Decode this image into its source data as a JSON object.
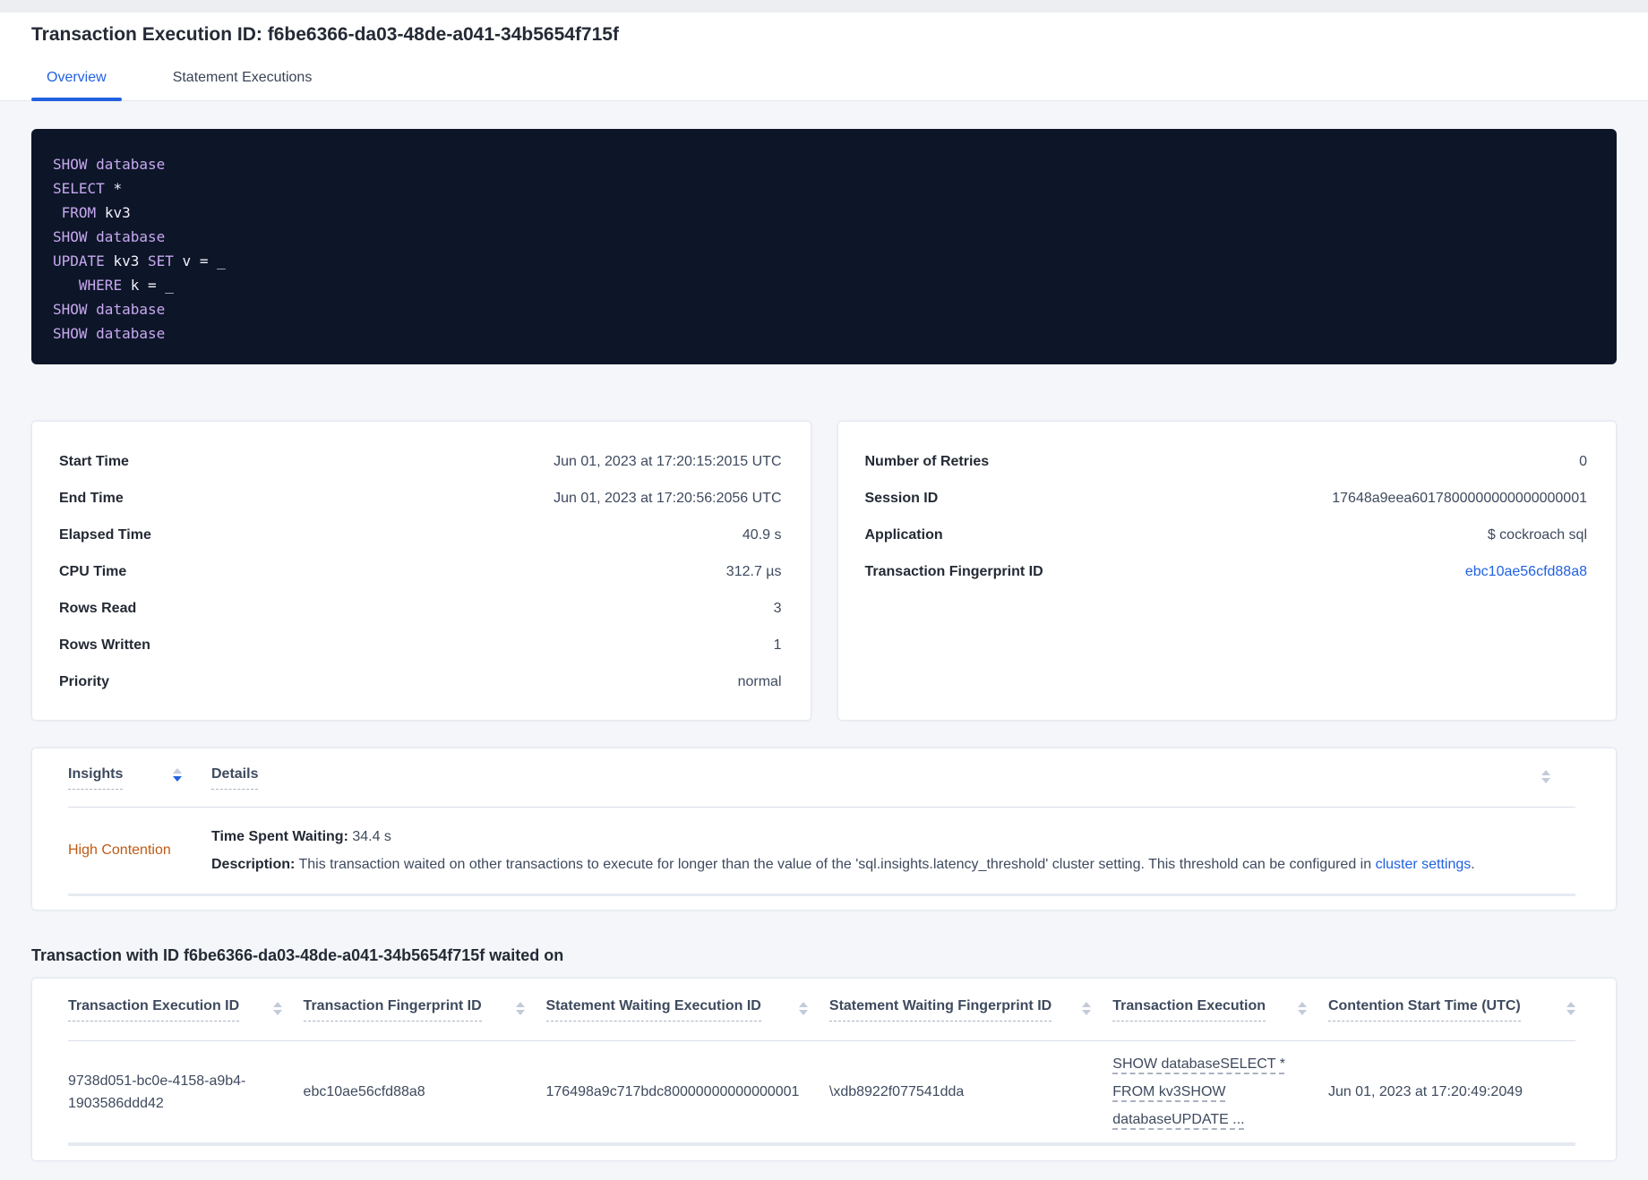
{
  "colors": {
    "accent_blue": "#2161E0",
    "insight_orange": "#C05A13",
    "sql_keyword_purple": "#C7A8F0",
    "sql_box_bg": "#0D1628"
  },
  "page": {
    "title": "Transaction Execution ID: f6be6366-da03-48de-a041-34b5654f715f",
    "tabs": [
      {
        "label": "Overview"
      },
      {
        "label": "Statement Executions"
      }
    ]
  },
  "sql_box": {
    "keywords": [
      "SHOW",
      "SELECT",
      "FROM",
      "UPDATE",
      "SET",
      "WHERE",
      "database"
    ],
    "lines": [
      "SHOW database",
      "SELECT *",
      " FROM kv3",
      "SHOW database",
      "UPDATE kv3 SET v = _",
      "   WHERE k = _",
      "SHOW database",
      "SHOW database"
    ]
  },
  "summary_left": {
    "rows": [
      {
        "label": "Start Time",
        "value": "Jun 01, 2023 at 17:20:15:2015 UTC"
      },
      {
        "label": "End Time",
        "value": "Jun 01, 2023 at 17:20:56:2056 UTC"
      },
      {
        "label": "Elapsed Time",
        "value": "40.9 s"
      },
      {
        "label": "CPU Time",
        "value": "312.7 µs"
      },
      {
        "label": "Rows Read",
        "value": "3"
      },
      {
        "label": "Rows Written",
        "value": "1"
      },
      {
        "label": "Priority",
        "value": "normal"
      }
    ]
  },
  "summary_right": {
    "rows": [
      {
        "label": "Number of Retries",
        "value": "0"
      },
      {
        "label": "Session ID",
        "value": "17648a9eea6017800000000000000001"
      },
      {
        "label": "Application",
        "value": "$ cockroach sql"
      },
      {
        "label": "Transaction Fingerprint ID",
        "value": "ebc10ae56cfd88a8"
      }
    ]
  },
  "insights_table": {
    "col_insights": "Insights",
    "col_details": "Details",
    "row": {
      "insight": "High Contention",
      "time_label": "Time Spent Waiting:",
      "time_value": "34.4 s",
      "desc_label": "Description:",
      "desc_text": "This transaction waited on other transactions to execute for longer than the value of the 'sql.insights.latency_threshold' cluster setting. This threshold can be configured in ",
      "desc_link": "cluster settings",
      "desc_after": "."
    }
  },
  "waited_on": {
    "heading": "Transaction with ID f6be6366-da03-48de-a041-34b5654f715f waited on",
    "columns": [
      "Transaction Execution ID",
      "Transaction Fingerprint ID",
      "Statement Waiting Execution ID",
      "Statement Waiting Fingerprint ID",
      "Transaction Execution",
      "Contention Start Time (UTC)"
    ],
    "row": {
      "transaction_execution_id": "9738d051-bc0e-4158-a9b4-1903586ddd42",
      "transaction_fingerprint_id": "ebc10ae56cfd88a8",
      "statement_waiting_execution_id": "176498a9c717bdc80000000000000001",
      "statement_waiting_fingerprint_id": "\\xdb8922f077541dda",
      "transaction_execution": "SHOW databaseSELECT * FROM kv3SHOW databaseUPDATE ...",
      "contention_start_time": "Jun 01, 2023 at 17:20:49:2049"
    }
  }
}
